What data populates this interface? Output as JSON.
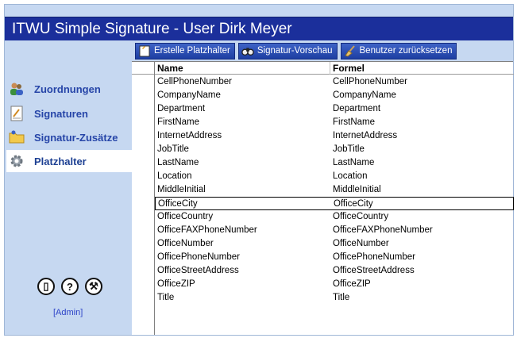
{
  "app": {
    "title": "ITWU Simple Signature - User Dirk Meyer"
  },
  "sidebar": {
    "items": [
      {
        "label": "Zuordnungen",
        "icon": "users-icon",
        "active": false
      },
      {
        "label": "Signaturen",
        "icon": "document-icon",
        "active": false
      },
      {
        "label": "Signatur-Zusätze",
        "icon": "folder-icon",
        "active": false
      },
      {
        "label": "Platzhalter",
        "icon": "gear-icon",
        "active": true
      }
    ],
    "round_buttons": [
      {
        "label": "▯",
        "icon": "door-icon"
      },
      {
        "label": "?",
        "icon": "help-icon"
      },
      {
        "label": "⚒",
        "icon": "wrench-icon"
      }
    ],
    "admin_link": "[Admin]"
  },
  "toolbar": {
    "buttons": [
      {
        "label": "Erstelle Platzhalter",
        "icon": "new-placeholder-icon"
      },
      {
        "label": "Signatur-Vorschau",
        "icon": "binoculars-icon"
      },
      {
        "label": "Benutzer zurücksetzen",
        "icon": "broom-icon"
      }
    ]
  },
  "grid": {
    "columns": [
      "Name",
      "Formel"
    ],
    "selected_index": 9,
    "rows": [
      {
        "name": "CellPhoneNumber",
        "formel": "CellPhoneNumber"
      },
      {
        "name": "CompanyName",
        "formel": "CompanyName"
      },
      {
        "name": "Department",
        "formel": "Department"
      },
      {
        "name": "FirstName",
        "formel": "FirstName"
      },
      {
        "name": "InternetAddress",
        "formel": "InternetAddress"
      },
      {
        "name": "JobTitle",
        "formel": "JobTitle"
      },
      {
        "name": "LastName",
        "formel": "LastName"
      },
      {
        "name": "Location",
        "formel": "Location"
      },
      {
        "name": "MiddleInitial",
        "formel": "MiddleInitial"
      },
      {
        "name": "OfficeCity",
        "formel": "OfficeCity"
      },
      {
        "name": "OfficeCountry",
        "formel": "OfficeCountry"
      },
      {
        "name": "OfficeFAXPhoneNumber",
        "formel": "OfficeFAXPhoneNumber"
      },
      {
        "name": "OfficeNumber",
        "formel": "OfficeNumber"
      },
      {
        "name": "OfficePhoneNumber",
        "formel": "OfficePhoneNumber"
      },
      {
        "name": "OfficeStreetAddress",
        "formel": "OfficeStreetAddress"
      },
      {
        "name": "OfficeZIP",
        "formel": "OfficeZIP"
      },
      {
        "name": "Title",
        "formel": "Title"
      }
    ]
  },
  "colors": {
    "titlebar": "#1b2f9b",
    "sidebar": "#c6d8f1",
    "nav_text": "#2645a8",
    "button": "#2a4bb4"
  }
}
